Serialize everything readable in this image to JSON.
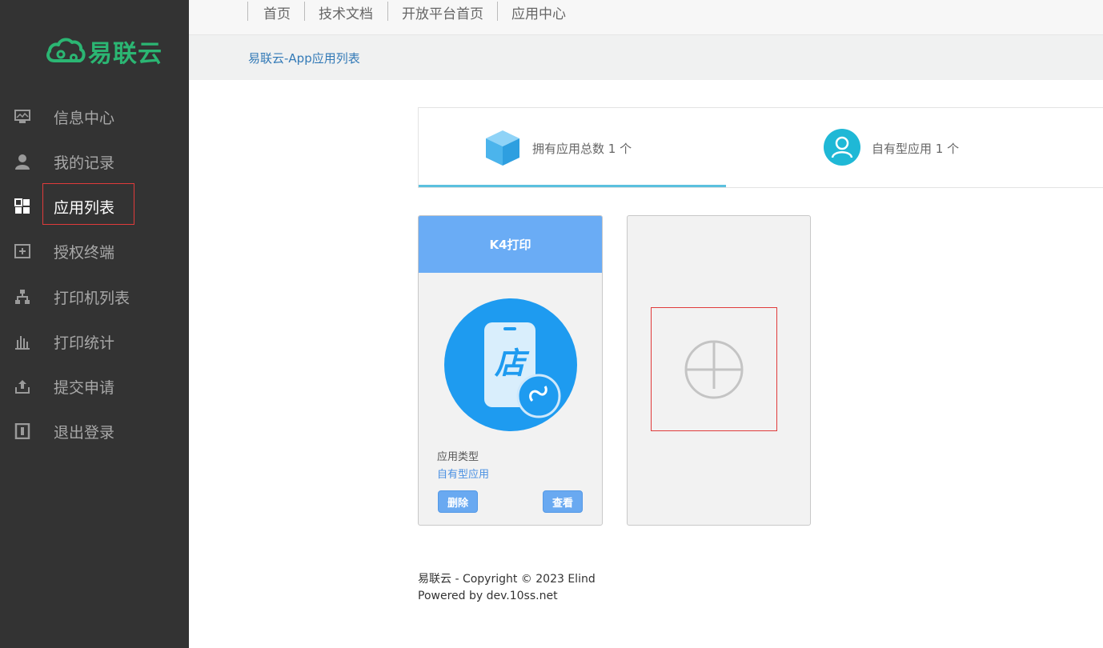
{
  "brand": {
    "name": "易联云",
    "color": "#2bb673"
  },
  "sidebar": {
    "items": [
      {
        "label": "信息中心",
        "icon": "monitor-icon",
        "active": false
      },
      {
        "label": "我的记录",
        "icon": "user-icon",
        "active": false
      },
      {
        "label": "应用列表",
        "icon": "grid-icon",
        "active": true
      },
      {
        "label": "授权终端",
        "icon": "add-terminal-icon",
        "active": false
      },
      {
        "label": "打印机列表",
        "icon": "sitemap-icon",
        "active": false
      },
      {
        "label": "打印统计",
        "icon": "bar-chart-icon",
        "active": false
      },
      {
        "label": "提交申请",
        "icon": "upload-icon",
        "active": false
      },
      {
        "label": "退出登录",
        "icon": "logout-icon",
        "active": false
      }
    ]
  },
  "topnav": {
    "links": [
      "首页",
      "技术文档",
      "开放平台首页",
      "应用中心"
    ]
  },
  "breadcrumb": {
    "text": "易联云-App应用列表"
  },
  "stats": {
    "total_apps": "拥有应用总数 1 个",
    "own_apps": "自有型应用 1 个"
  },
  "app_card": {
    "title": "K4打印",
    "type_label": "应用类型",
    "type_value": "自有型应用",
    "delete_label": "删除",
    "view_label": "查看",
    "icon": "shop-mini-program-icon"
  },
  "add_card": {
    "icon": "plus-circle-icon"
  },
  "footer": {
    "line1": "易联云 - Copyright © 2023 Elind",
    "line2": "Powered by dev.10ss.net"
  },
  "colors": {
    "sidebar_bg": "#333333",
    "accent": "#6aacf5",
    "link": "#337ab7",
    "highlight_border": "#e03b3b"
  }
}
